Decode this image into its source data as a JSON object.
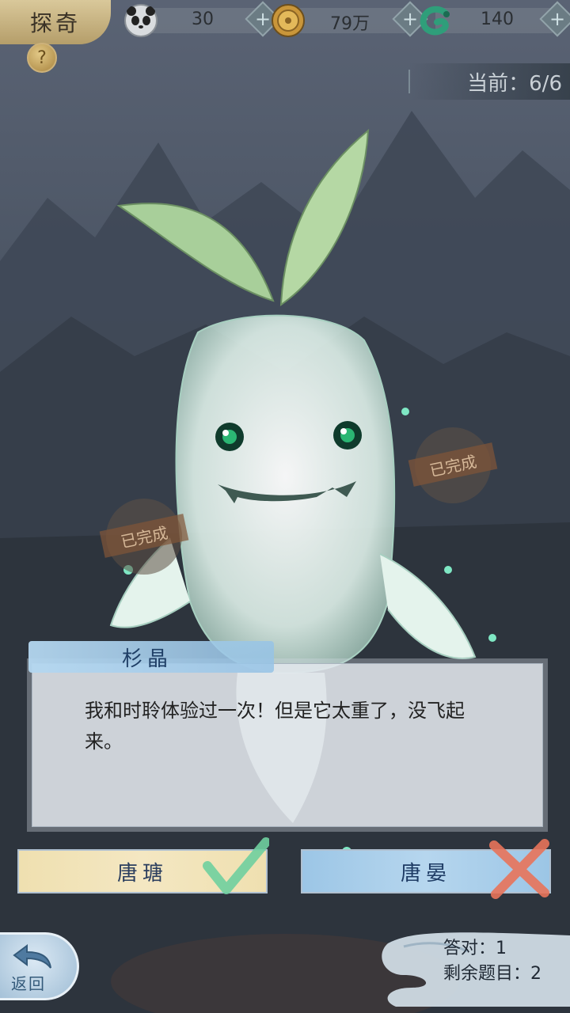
{
  "header": {
    "title": "探奇",
    "help_icon": "?",
    "resources": [
      {
        "name": "panda",
        "value": "30"
      },
      {
        "name": "coin",
        "value": "79万"
      },
      {
        "name": "jade",
        "value": "140"
      }
    ],
    "plus_symbol": "+"
  },
  "progress": {
    "label": "当前：6/6"
  },
  "stamps": {
    "completed_label": "已完成"
  },
  "dialog": {
    "speaker": "杉晶",
    "text": "我和时聆体验过一次！但是它太重了，没飞起来。"
  },
  "answers": [
    {
      "label": "唐瑭",
      "status": "correct"
    },
    {
      "label": "唐晏",
      "status": "wrong"
    }
  ],
  "back_button": {
    "label": "返回"
  },
  "stats": {
    "correct_line": "答对：1",
    "remaining_line": "剩余题目：2"
  },
  "colors": {
    "correct_mark": "#7dd3a8",
    "wrong_mark": "#e8735a",
    "accent_blue": "#9cc6e6"
  },
  "icons": [
    "help-icon",
    "panda-icon",
    "coin-icon",
    "jade-icon",
    "plus-icon",
    "check-icon",
    "cross-icon",
    "back-arrow-icon"
  ]
}
